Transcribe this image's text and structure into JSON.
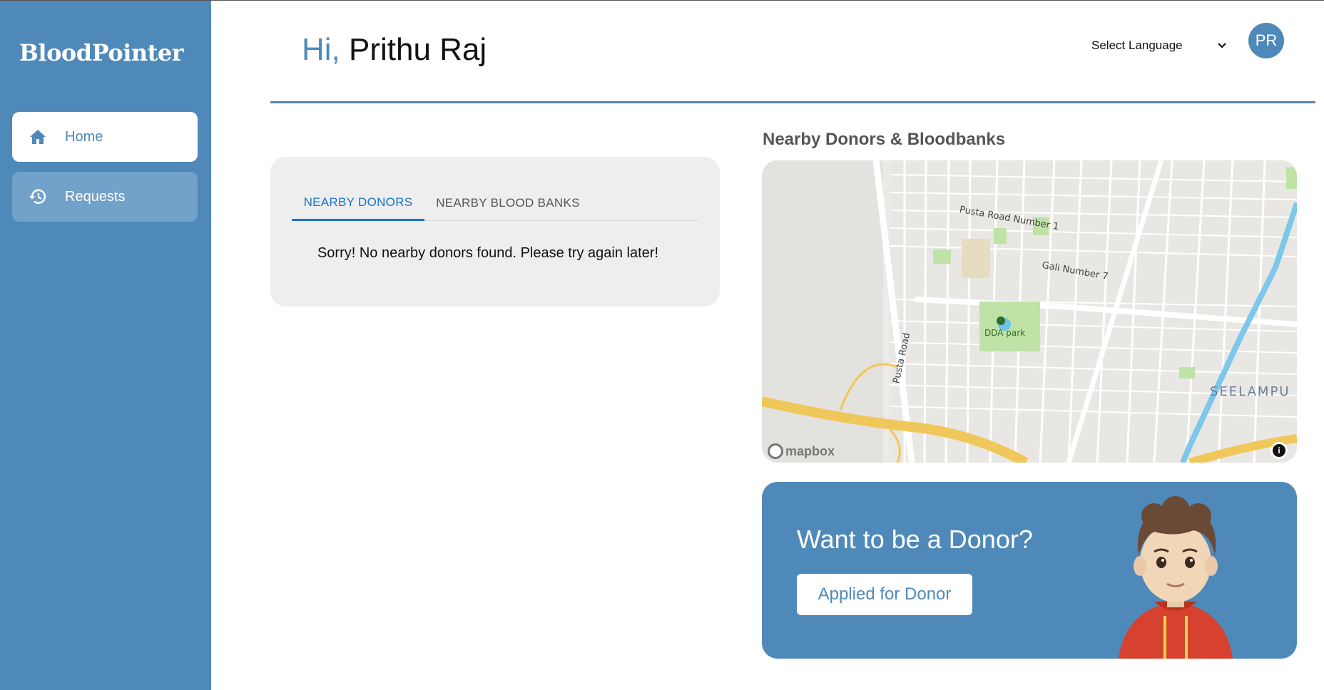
{
  "app": {
    "brand": "BloodPointer"
  },
  "sidebar": {
    "items": [
      {
        "label": "Home",
        "icon": "home-icon",
        "active": true
      },
      {
        "label": "Requests",
        "icon": "history-icon",
        "active": false
      }
    ]
  },
  "header": {
    "greeting_hi": "Hi,",
    "user_name": "Prithu Raj",
    "language_label": "Select Language",
    "avatar_initials": "PR"
  },
  "tabs_card": {
    "tabs": [
      {
        "label": "NEARBY DONORS",
        "selected": true
      },
      {
        "label": "NEARBY BLOOD BANKS",
        "selected": false
      }
    ],
    "empty_message": "Sorry! No nearby donors found. Please try again later!"
  },
  "map_section": {
    "title": "Nearby Donors & Bloodbanks",
    "labels": {
      "road1": "Pusta Road Number 1",
      "road2": "Gali Number 7",
      "road3": "Pusta Road",
      "park": "DDA park",
      "area": "SEELAMPU"
    },
    "attribution": "mapbox",
    "info_symbol": "i"
  },
  "donor_card": {
    "title": "Want to be a Donor?",
    "button_label": "Applied for Donor"
  },
  "colors": {
    "primary": "#4f89b9",
    "tab_active": "#1a73c8",
    "card_bg": "#eeeeee"
  }
}
